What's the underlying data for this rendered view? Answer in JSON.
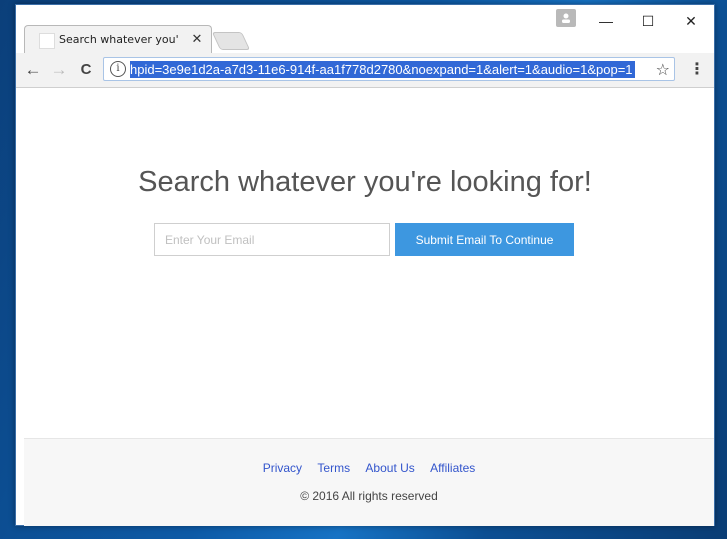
{
  "browser": {
    "tab_title": "Search whatever you're l",
    "tab_close": "✕",
    "url": "hpid=3e9e1d2a-a7d3-11e6-914f-aa1f778d2780&noexpand=1&alert=1&audio=1&pop=1",
    "info_glyph": "i",
    "star_glyph": "☆",
    "menu_glyph": "⋮",
    "back_glyph": "←",
    "forward_glyph": "→",
    "reload_glyph": "C",
    "minimize_glyph": "—",
    "maximize_glyph": "☐",
    "close_glyph": "✕"
  },
  "page": {
    "headline": "Search whatever you're looking for!",
    "email_placeholder": "Enter Your Email",
    "submit_label": "Submit Email To Continue"
  },
  "footer": {
    "links": [
      "Privacy",
      "Terms",
      "About Us",
      "Affiliates"
    ],
    "copyright": "© 2016 All rights reserved"
  },
  "colors": {
    "accent": "#3d97e0",
    "link": "#3355cc",
    "selection": "#3168d6"
  }
}
